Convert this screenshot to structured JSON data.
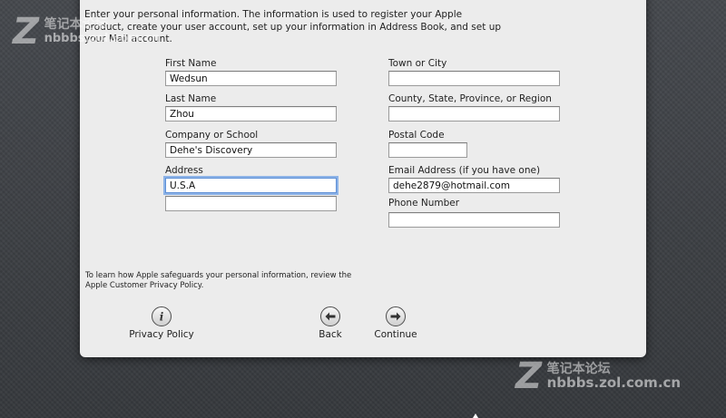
{
  "intro_text": "Enter your personal information. The information is used to register your Apple product, create your user account, set up your information in Address Book, and set up your Mail account.",
  "form": {
    "first_name": {
      "label": "First Name",
      "value": "Wedsun"
    },
    "last_name": {
      "label": "Last Name",
      "value": "Zhou"
    },
    "company": {
      "label": "Company or School",
      "value": "Dehe's Discovery"
    },
    "address": {
      "label": "Address",
      "value": "U.S.A",
      "value2": ""
    },
    "town": {
      "label": "Town or City",
      "value": ""
    },
    "county": {
      "label": "County, State, Province, or Region",
      "value": ""
    },
    "postal": {
      "label": "Postal Code",
      "value": ""
    },
    "email": {
      "label": "Email Address (if you have one)",
      "value": "dehe2879@hotmail.com"
    },
    "phone": {
      "label": "Phone Number",
      "value": ""
    }
  },
  "privacy_note": "To learn how Apple safeguards your personal information, review the Apple Customer Privacy Policy.",
  "buttons": {
    "privacy_policy": {
      "label": "Privacy Policy",
      "icon": "info-icon"
    },
    "back": {
      "label": "Back",
      "icon": "left-arrow-icon"
    },
    "continue": {
      "label": "Continue",
      "icon": "right-arrow-icon"
    }
  },
  "watermark": {
    "site_cn": "笔记本论坛",
    "site_url": "nbbbs.zol.com.cn"
  }
}
